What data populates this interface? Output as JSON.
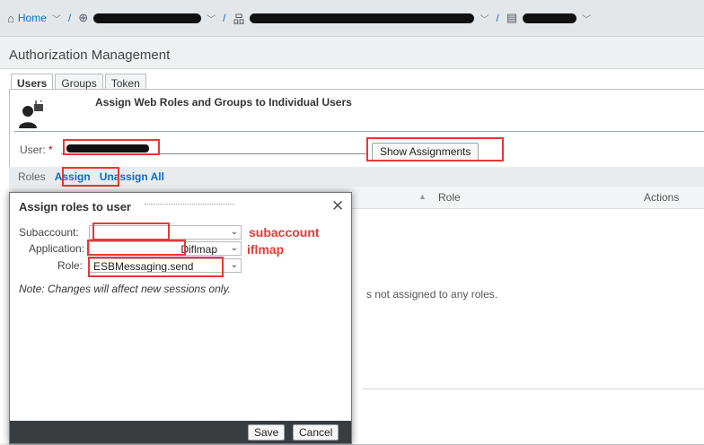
{
  "breadcrumb": {
    "home_label": "Home"
  },
  "page": {
    "title": "Authorization Management"
  },
  "tabs": [
    {
      "label": "Users"
    },
    {
      "label": "Groups"
    },
    {
      "label": "Token"
    }
  ],
  "section": {
    "heading": "Assign Web Roles and Groups to Individual Users"
  },
  "user_field": {
    "label": "User:",
    "required_mark": "*"
  },
  "show_assignments_label": "Show Assignments",
  "action_bar": {
    "roles_label": "Roles",
    "assign_label": "Assign",
    "unassign_all_label": "Unassign All"
  },
  "table": {
    "columns": [
      "Role",
      "Actions"
    ],
    "empty_message": "s not assigned to any roles."
  },
  "dialog": {
    "title": "Assign roles to user",
    "subaccount_label": "Subaccount:",
    "application_label": "Application:",
    "application_value": "Diflmap",
    "role_label": "Role:",
    "role_value": "ESBMessaging.send",
    "note": "Note: Changes will affect new sessions only.",
    "save_label": "Save",
    "cancel_label": "Cancel"
  },
  "annotations": {
    "subaccount": "subaccount",
    "iflmap": "iflmap"
  },
  "colors": {
    "accent": "#0a6ed1",
    "highlight": "#e53935",
    "dialog_footer": "#3a3d40"
  }
}
